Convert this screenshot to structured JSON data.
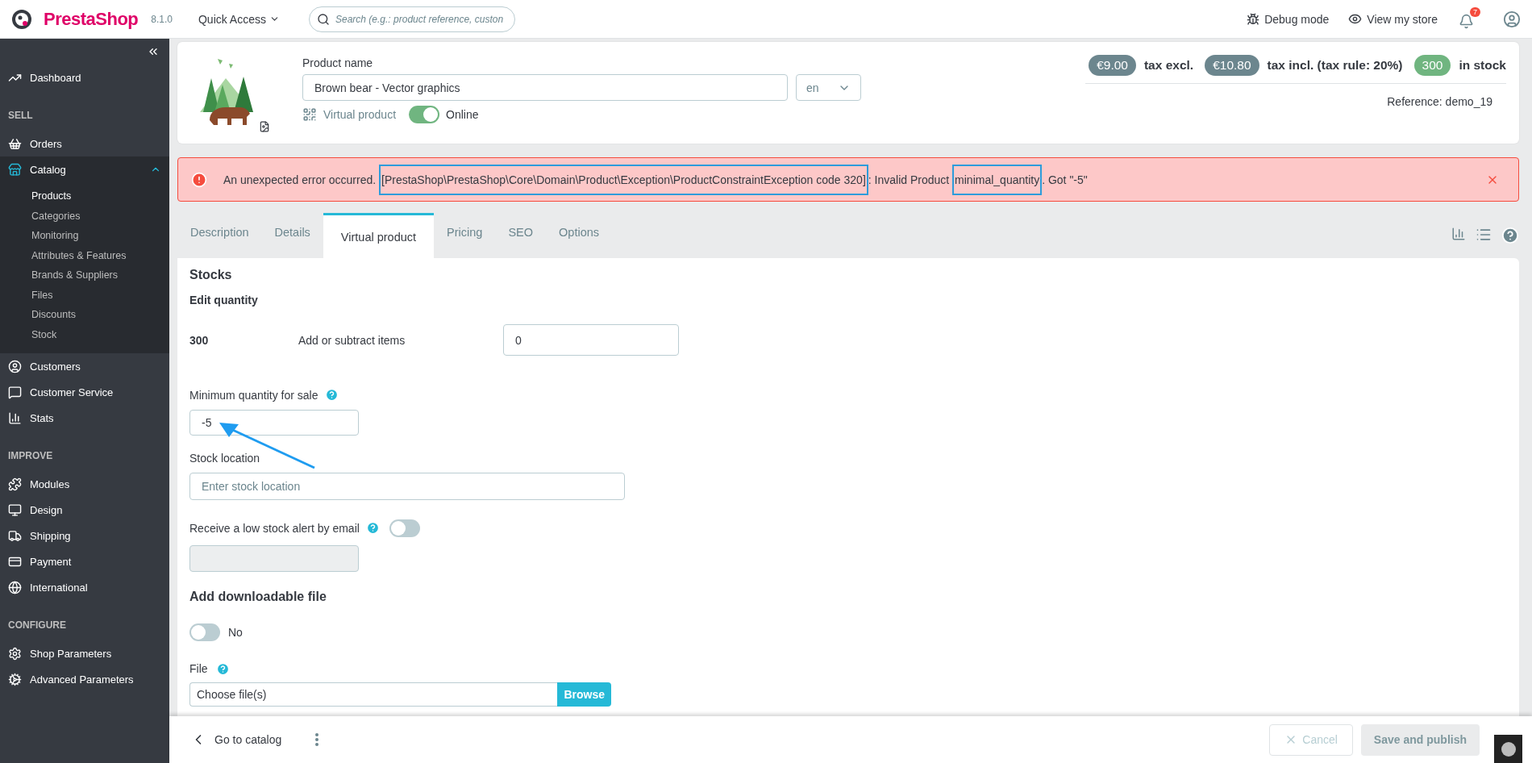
{
  "topbar": {
    "logo": "PrestaShop",
    "version": "8.1.0",
    "quick_access": "Quick Access",
    "search_placeholder": "Search (e.g.: product reference, custon",
    "debug": "Debug mode",
    "view_store": "View my store",
    "notifications": "7"
  },
  "sidebar": {
    "sections": [
      {
        "items": [
          {
            "label": "Dashboard",
            "selected": false
          }
        ]
      },
      {
        "title": "SELL",
        "items": [
          {
            "label": "Orders",
            "selected": false
          },
          {
            "label": "Catalog",
            "selected": true,
            "expanded": true,
            "children": [
              {
                "label": "Products",
                "selected": true
              },
              {
                "label": "Categories",
                "selected": false
              },
              {
                "label": "Monitoring",
                "selected": false
              },
              {
                "label": "Attributes & Features",
                "selected": false
              },
              {
                "label": "Brands & Suppliers",
                "selected": false
              },
              {
                "label": "Files",
                "selected": false
              },
              {
                "label": "Discounts",
                "selected": false
              },
              {
                "label": "Stock",
                "selected": false
              }
            ]
          },
          {
            "label": "Customers",
            "selected": false
          },
          {
            "label": "Customer Service",
            "selected": false
          },
          {
            "label": "Stats",
            "selected": false
          }
        ]
      },
      {
        "title": "IMPROVE",
        "items": [
          {
            "label": "Modules",
            "selected": false
          },
          {
            "label": "Design",
            "selected": false
          },
          {
            "label": "Shipping",
            "selected": false
          },
          {
            "label": "Payment",
            "selected": false
          },
          {
            "label": "International",
            "selected": false
          }
        ]
      },
      {
        "title": "CONFIGURE",
        "items": [
          {
            "label": "Shop Parameters",
            "selected": false
          },
          {
            "label": "Advanced Parameters",
            "selected": false
          }
        ]
      }
    ]
  },
  "header": {
    "name_label": "Product name",
    "name_value": "Brown bear - Vector graphics",
    "language": "en",
    "type_label": "Virtual product",
    "online": {
      "label": "Online",
      "on": true
    },
    "badges": [
      {
        "kind": "price",
        "amount": "€9.00",
        "label": "tax excl."
      },
      {
        "kind": "price",
        "amount": "€10.80",
        "label": "tax incl. (tax rule: 20%)"
      },
      {
        "kind": "stock",
        "amount": "300",
        "label": "in stock"
      }
    ],
    "reference": "Reference: demo_19"
  },
  "error": {
    "segments": [
      {
        "text": "An unexpected error occurred. ",
        "highlighted": false
      },
      {
        "text": "[PrestaShop\\PrestaShop\\Core\\Domain\\Product\\Exception\\ProductConstraintException code 320]",
        "highlighted": true
      },
      {
        "text": ": Invalid Product ",
        "highlighted": false
      },
      {
        "text": "minimal_quantity",
        "highlighted": true
      },
      {
        "text": ". Got \"-5\"",
        "highlighted": false
      }
    ]
  },
  "tabs": [
    {
      "label": "Description",
      "selected": false
    },
    {
      "label": "Details",
      "selected": false
    },
    {
      "label": "Virtual product",
      "selected": true
    },
    {
      "label": "Pricing",
      "selected": false
    },
    {
      "label": "SEO",
      "selected": false
    },
    {
      "label": "Options",
      "selected": false
    }
  ],
  "stocks": {
    "title": "Stocks",
    "edit_title": "Edit quantity",
    "quantity": "300",
    "delta_label": "Add or subtract items",
    "delta_value": "0",
    "min_label": "Minimum quantity for sale",
    "min_value": "-5",
    "location_label": "Stock location",
    "location_placeholder": "Enter stock location",
    "alert_label": "Receive a low stock alert by email",
    "alert_on": false
  },
  "download": {
    "title": "Add downloadable file",
    "on": false,
    "toggle_label": "No",
    "file_label": "File",
    "file_text": "Choose file(s)",
    "browse": "Browse"
  },
  "footer": {
    "back": "Go to catalog",
    "cancel": "Cancel",
    "save": {
      "label": "Save and publish",
      "disabled": true
    }
  }
}
